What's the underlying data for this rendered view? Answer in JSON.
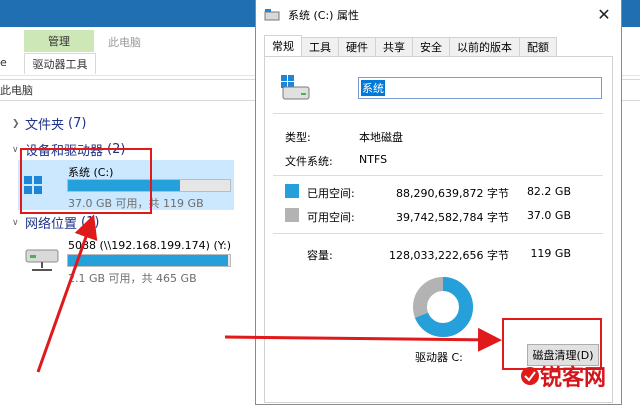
{
  "explorer": {
    "tab_manage": "管理",
    "tab_this_pc": "此电脑",
    "tab_left": "e",
    "tab_drive_tools": "驱动器工具",
    "address": "此电脑",
    "groups": [
      {
        "label": "文件夹",
        "count": "(7)"
      },
      {
        "label": "设备和驱动器",
        "count": "(2)"
      },
      {
        "label": "网络位置",
        "count": "(1)"
      }
    ],
    "drive_c": {
      "name": "系统 (C:)",
      "free": "37.0 GB 可用，共 119 GB",
      "used_fraction": 0.69
    },
    "net_drive": {
      "name": "5088 (\\\\192.168.199.174) (Y:)",
      "free": "2.1 GB 可用，共 465 GB",
      "used_fraction": 0.99
    }
  },
  "dialog": {
    "title": "系统 (C:) 属性",
    "close": "✕",
    "tabs": [
      "常规",
      "工具",
      "硬件",
      "共享",
      "安全",
      "以前的版本",
      "配额"
    ],
    "name_value": "系统",
    "type_label": "类型:",
    "type_value": "本地磁盘",
    "fs_label": "文件系统:",
    "fs_value": "NTFS",
    "used_label": "已用空间:",
    "used_bytes": "88,290,639,872 字节",
    "used_gb": "82.2 GB",
    "free_label": "可用空间:",
    "free_bytes": "39,742,582,784 字节",
    "free_gb": "37.0 GB",
    "capacity_label": "容量:",
    "capacity_bytes": "128,033,222,656 字节",
    "capacity_gb": "119 GB",
    "drive_label": "驱动器 C:",
    "cleanup_button": "磁盘清理(D)",
    "used_color": "#26a0da",
    "free_color": "#b3b3b3"
  },
  "watermark": {
    "text": "锐客网"
  }
}
